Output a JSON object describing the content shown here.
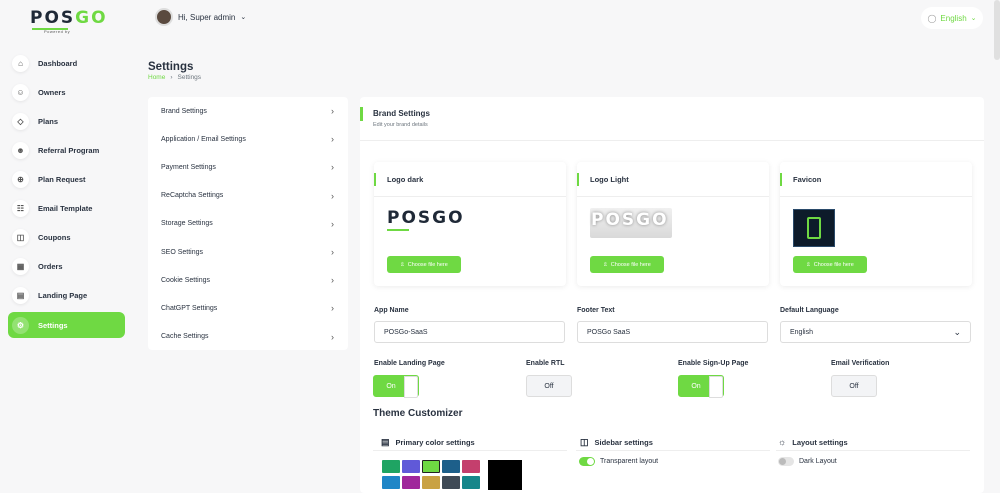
{
  "brand": {
    "logo_prefix": "POS",
    "logo_suffix": "GO",
    "tagline": "Powered by"
  },
  "topbar": {
    "greeting": "Hi, Super admin",
    "language": "English"
  },
  "sidebar": {
    "items": [
      {
        "label": "Dashboard",
        "icon": "home-icon"
      },
      {
        "label": "Owners",
        "icon": "users-icon"
      },
      {
        "label": "Plans",
        "icon": "trophy-icon"
      },
      {
        "label": "Referral Program",
        "icon": "user-share-icon"
      },
      {
        "label": "Plan Request",
        "icon": "request-icon"
      },
      {
        "label": "Email Template",
        "icon": "template-icon"
      },
      {
        "label": "Coupons",
        "icon": "gift-icon"
      },
      {
        "label": "Orders",
        "icon": "calendar-icon"
      },
      {
        "label": "Landing Page",
        "icon": "page-icon"
      },
      {
        "label": "Settings",
        "icon": "settings-icon",
        "active": true
      }
    ]
  },
  "header": {
    "title": "Settings",
    "breadcrumb": {
      "home": "Home",
      "current": "Settings"
    }
  },
  "settings_menu": [
    "Brand Settings",
    "Application / Email Settings",
    "Payment Settings",
    "ReCaptcha Settings",
    "Storage Settings",
    "SEO Settings",
    "Cookie Settings",
    "ChatGPT Settings",
    "Cache Settings"
  ],
  "brand_settings": {
    "title": "Brand Settings",
    "subtitle": "Edit your brand details",
    "logo_cards": [
      {
        "title": "Logo dark",
        "button": "Choose file here"
      },
      {
        "title": "Logo Light",
        "button": "Choose file here"
      },
      {
        "title": "Favicon",
        "button": "Choose file here"
      }
    ],
    "app_name": {
      "label": "App Name",
      "value": "POSGo-SaaS"
    },
    "footer_text": {
      "label": "Footer Text",
      "value": "POSGo SaaS"
    },
    "default_language": {
      "label": "Default Language",
      "value": "English"
    },
    "toggles": [
      {
        "label": "Enable Landing Page",
        "state": "On",
        "on": true
      },
      {
        "label": "Enable RTL",
        "state": "Off",
        "on": false
      },
      {
        "label": "Enable Sign-Up Page",
        "state": "On",
        "on": true
      },
      {
        "label": "Email Verification",
        "state": "Off",
        "on": false
      }
    ]
  },
  "theme_customizer": {
    "title": "Theme Customizer",
    "primary_color": {
      "title": "Primary color settings",
      "swatches": [
        "#1fa463",
        "#6059d8",
        "#6fd943",
        "#1d5f8a",
        "#c43f6d",
        "#1f86c7",
        "#a0279b",
        "#c9a243",
        "#3f4a56",
        "#16868a"
      ],
      "selected": "#6fd943",
      "custom": "#000000"
    },
    "sidebar": {
      "title": "Sidebar settings",
      "option": "Transparent layout",
      "on": true
    },
    "layout": {
      "title": "Layout settings",
      "option": "Dark Layout",
      "on": false
    }
  },
  "colors": {
    "accent": "#6fd943"
  }
}
